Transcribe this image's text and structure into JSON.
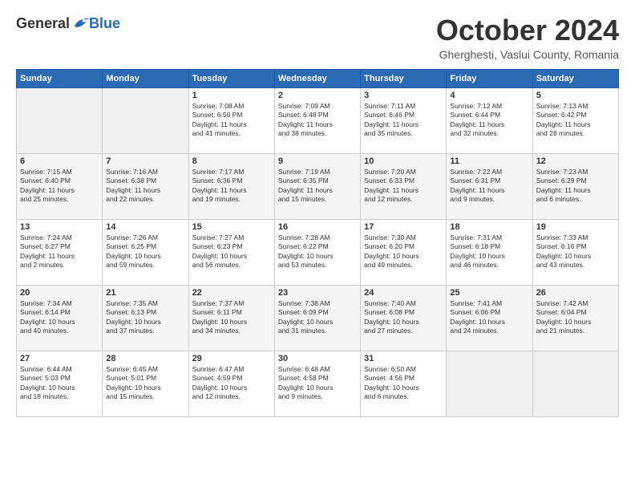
{
  "header": {
    "logo_general": "General",
    "logo_blue": "Blue",
    "month": "October 2024",
    "location": "Gherghesti, Vaslui County, Romania"
  },
  "weekdays": [
    "Sunday",
    "Monday",
    "Tuesday",
    "Wednesday",
    "Thursday",
    "Friday",
    "Saturday"
  ],
  "weeks": [
    [
      {
        "day": "",
        "info": ""
      },
      {
        "day": "",
        "info": ""
      },
      {
        "day": "1",
        "info": "Sunrise: 7:08 AM\nSunset: 6:50 PM\nDaylight: 11 hours\nand 41 minutes."
      },
      {
        "day": "2",
        "info": "Sunrise: 7:09 AM\nSunset: 6:48 PM\nDaylight: 11 hours\nand 38 minutes."
      },
      {
        "day": "3",
        "info": "Sunrise: 7:11 AM\nSunset: 6:46 PM\nDaylight: 11 hours\nand 35 minutes."
      },
      {
        "day": "4",
        "info": "Sunrise: 7:12 AM\nSunset: 6:44 PM\nDaylight: 11 hours\nand 32 minutes."
      },
      {
        "day": "5",
        "info": "Sunrise: 7:13 AM\nSunset: 6:42 PM\nDaylight: 11 hours\nand 28 minutes."
      }
    ],
    [
      {
        "day": "6",
        "info": "Sunrise: 7:15 AM\nSunset: 6:40 PM\nDaylight: 11 hours\nand 25 minutes."
      },
      {
        "day": "7",
        "info": "Sunrise: 7:16 AM\nSunset: 6:38 PM\nDaylight: 11 hours\nand 22 minutes."
      },
      {
        "day": "8",
        "info": "Sunrise: 7:17 AM\nSunset: 6:36 PM\nDaylight: 11 hours\nand 19 minutes."
      },
      {
        "day": "9",
        "info": "Sunrise: 7:19 AM\nSunset: 6:35 PM\nDaylight: 11 hours\nand 15 minutes."
      },
      {
        "day": "10",
        "info": "Sunrise: 7:20 AM\nSunset: 6:33 PM\nDaylight: 11 hours\nand 12 minutes."
      },
      {
        "day": "11",
        "info": "Sunrise: 7:22 AM\nSunset: 6:31 PM\nDaylight: 11 hours\nand 9 minutes."
      },
      {
        "day": "12",
        "info": "Sunrise: 7:23 AM\nSunset: 6:29 PM\nDaylight: 11 hours\nand 6 minutes."
      }
    ],
    [
      {
        "day": "13",
        "info": "Sunrise: 7:24 AM\nSunset: 6:27 PM\nDaylight: 11 hours\nand 2 minutes."
      },
      {
        "day": "14",
        "info": "Sunrise: 7:26 AM\nSunset: 6:25 PM\nDaylight: 10 hours\nand 59 minutes."
      },
      {
        "day": "15",
        "info": "Sunrise: 7:27 AM\nSunset: 6:23 PM\nDaylight: 10 hours\nand 56 minutes."
      },
      {
        "day": "16",
        "info": "Sunrise: 7:28 AM\nSunset: 6:22 PM\nDaylight: 10 hours\nand 53 minutes."
      },
      {
        "day": "17",
        "info": "Sunrise: 7:30 AM\nSunset: 6:20 PM\nDaylight: 10 hours\nand 49 minutes."
      },
      {
        "day": "18",
        "info": "Sunrise: 7:31 AM\nSunset: 6:18 PM\nDaylight: 10 hours\nand 46 minutes."
      },
      {
        "day": "19",
        "info": "Sunrise: 7:33 AM\nSunset: 6:16 PM\nDaylight: 10 hours\nand 43 minutes."
      }
    ],
    [
      {
        "day": "20",
        "info": "Sunrise: 7:34 AM\nSunset: 6:14 PM\nDaylight: 10 hours\nand 40 minutes."
      },
      {
        "day": "21",
        "info": "Sunrise: 7:35 AM\nSunset: 6:13 PM\nDaylight: 10 hours\nand 37 minutes."
      },
      {
        "day": "22",
        "info": "Sunrise: 7:37 AM\nSunset: 6:11 PM\nDaylight: 10 hours\nand 34 minutes."
      },
      {
        "day": "23",
        "info": "Sunrise: 7:38 AM\nSunset: 6:09 PM\nDaylight: 10 hours\nand 31 minutes."
      },
      {
        "day": "24",
        "info": "Sunrise: 7:40 AM\nSunset: 6:08 PM\nDaylight: 10 hours\nand 27 minutes."
      },
      {
        "day": "25",
        "info": "Sunrise: 7:41 AM\nSunset: 6:06 PM\nDaylight: 10 hours\nand 24 minutes."
      },
      {
        "day": "26",
        "info": "Sunrise: 7:42 AM\nSunset: 6:04 PM\nDaylight: 10 hours\nand 21 minutes."
      }
    ],
    [
      {
        "day": "27",
        "info": "Sunrise: 6:44 AM\nSunset: 5:03 PM\nDaylight: 10 hours\nand 18 minutes."
      },
      {
        "day": "28",
        "info": "Sunrise: 6:45 AM\nSunset: 5:01 PM\nDaylight: 10 hours\nand 15 minutes."
      },
      {
        "day": "29",
        "info": "Sunrise: 6:47 AM\nSunset: 4:59 PM\nDaylight: 10 hours\nand 12 minutes."
      },
      {
        "day": "30",
        "info": "Sunrise: 6:48 AM\nSunset: 4:58 PM\nDaylight: 10 hours\nand 9 minutes."
      },
      {
        "day": "31",
        "info": "Sunrise: 6:50 AM\nSunset: 4:56 PM\nDaylight: 10 hours\nand 6 minutes."
      },
      {
        "day": "",
        "info": ""
      },
      {
        "day": "",
        "info": ""
      }
    ]
  ]
}
